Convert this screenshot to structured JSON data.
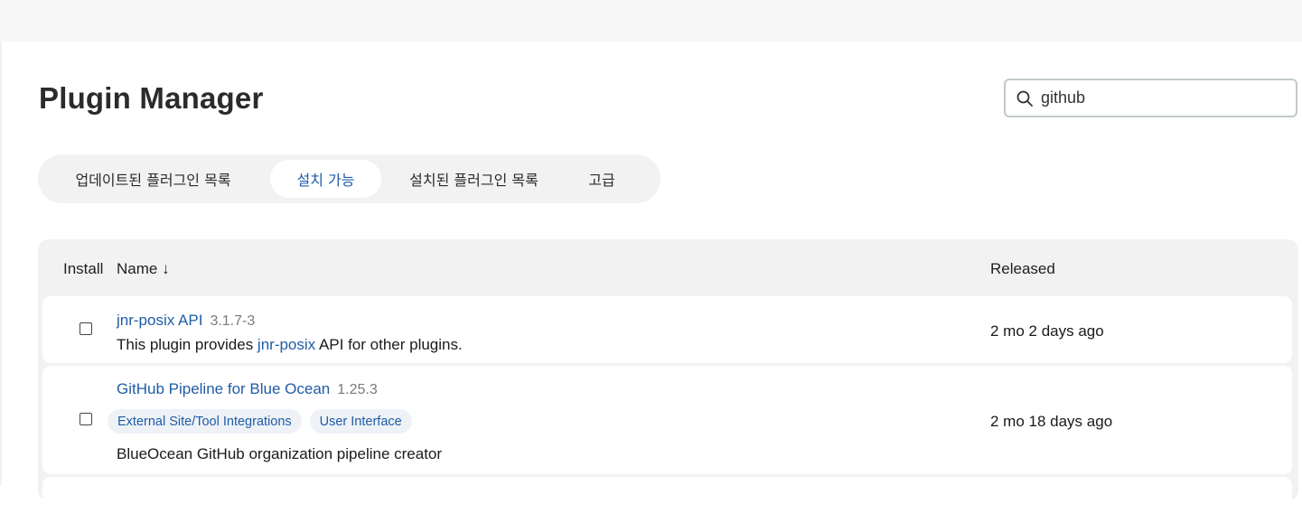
{
  "header": {
    "title": "Plugin Manager"
  },
  "search": {
    "value": "github",
    "icon": "search-icon"
  },
  "tabs": [
    {
      "label": "업데이트된 플러그인 목록",
      "active": false
    },
    {
      "label": "설치 가능",
      "active": true
    },
    {
      "label": "설치된 플러그인 목록",
      "active": false
    },
    {
      "label": "고급",
      "active": false
    }
  ],
  "table": {
    "columns": {
      "install": "Install",
      "name": "Name ↓",
      "released": "Released"
    },
    "rows": [
      {
        "name": "jnr-posix API",
        "version": "3.1.7-3",
        "description_prefix": "This plugin provides ",
        "description_link": "jnr-posix",
        "description_suffix": " API for other plugins.",
        "released": "2 mo 2 days ago",
        "checked": false
      },
      {
        "name": "GitHub Pipeline for Blue Ocean",
        "version": "1.25.3",
        "tags": [
          "External Site/Tool Integrations",
          "User Interface"
        ],
        "description": "BlueOcean GitHub organization pipeline creator",
        "released": "2 mo 18 days ago",
        "checked": false
      }
    ]
  },
  "colors": {
    "link": "#1f5ca6",
    "tab_bg": "#f2f2f2",
    "table_bg": "#f2f2f2"
  }
}
